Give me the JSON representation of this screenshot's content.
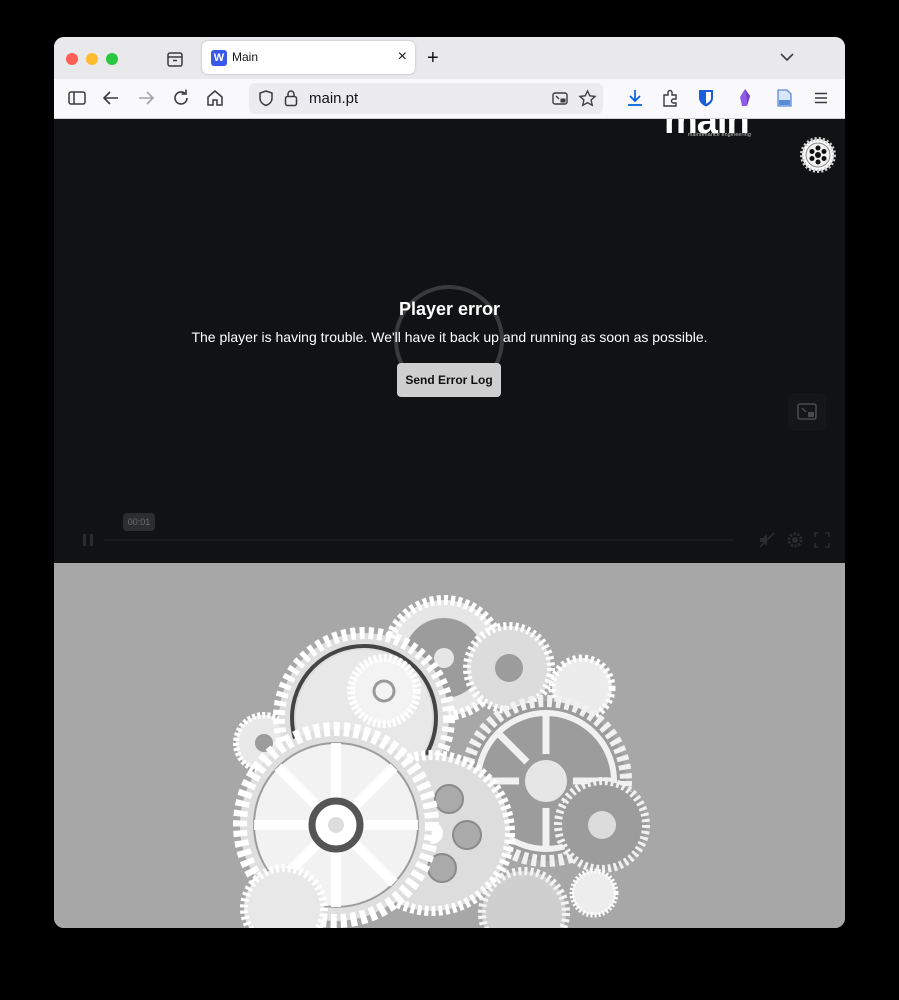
{
  "browser": {
    "tab": {
      "title": "Main",
      "favicon_letter": "W",
      "close_label": "×"
    },
    "new_tab_label": "+",
    "url": "main.pt"
  },
  "player": {
    "logo_text": "main",
    "logo_subtitle": "maintenance engineering",
    "error_title": "Player error",
    "error_message": "The player is having trouble. We'll have it back up and running as soon as possible.",
    "error_button": "Send Error Log",
    "time_tooltip": "00:01"
  }
}
